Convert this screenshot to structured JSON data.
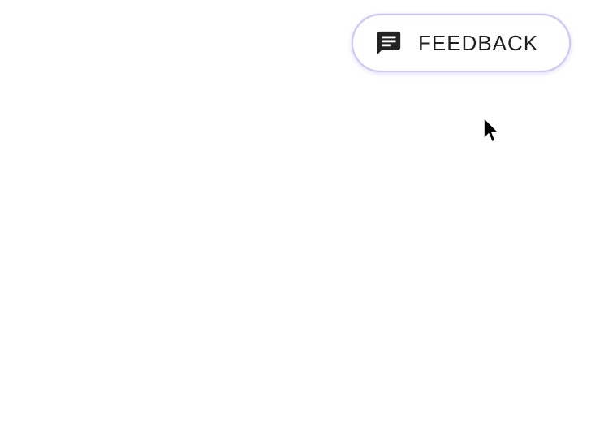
{
  "feedback_button": {
    "label": "FEEDBACK",
    "icon": "feedback-chat-icon",
    "border_color": "#cfc6f4",
    "text_color": "#1f1f1f"
  },
  "cursor": {
    "icon": "mouse-pointer-icon"
  }
}
